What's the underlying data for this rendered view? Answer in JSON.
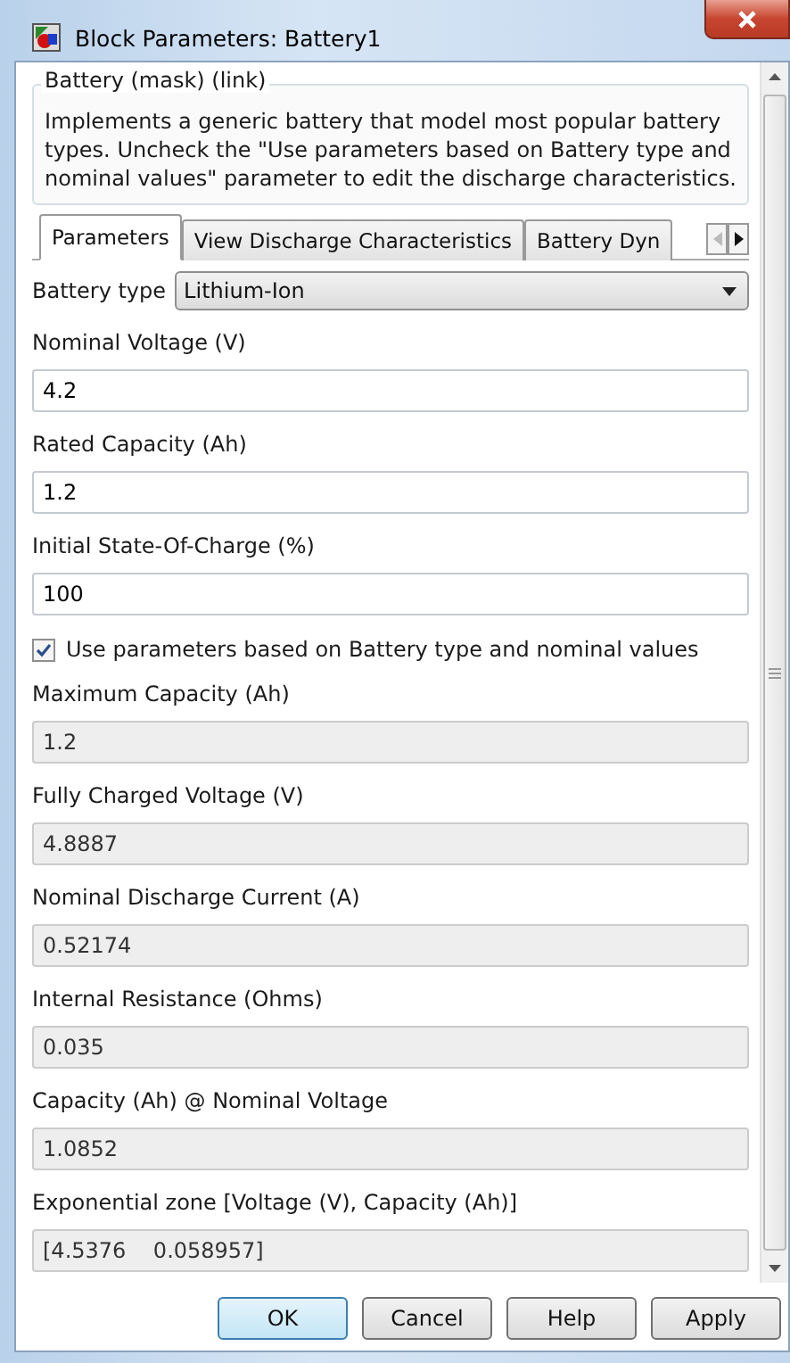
{
  "window": {
    "title": "Block Parameters: Battery1"
  },
  "description": {
    "title": "Battery (mask) (link)",
    "text": "Implements a generic battery that model most popular battery types. Uncheck the \"Use parameters based on Battery type and nominal values\" parameter to edit the discharge characteristics."
  },
  "tabs": [
    {
      "label": "Parameters",
      "selected": true
    },
    {
      "label": "View Discharge Characteristics",
      "selected": false
    },
    {
      "label": "Battery Dyn",
      "selected": false
    }
  ],
  "battery_type": {
    "label": "Battery type",
    "value": "Lithium-Ion"
  },
  "parameters": [
    {
      "kind": "field",
      "label": "Nominal Voltage (V)",
      "value": "4.2",
      "disabled": false
    },
    {
      "kind": "field",
      "label": "Rated Capacity (Ah)",
      "value": "1.2",
      "disabled": false
    },
    {
      "kind": "field",
      "label": "Initial State-Of-Charge (%)",
      "value": "100",
      "disabled": false
    },
    {
      "kind": "checkbox",
      "label": "Use parameters based on Battery type and nominal values",
      "checked": true
    },
    {
      "kind": "field",
      "label": "Maximum Capacity (Ah)",
      "value": "1.2",
      "disabled": true
    },
    {
      "kind": "field",
      "label": "Fully Charged Voltage (V)",
      "value": "4.8887",
      "disabled": true
    },
    {
      "kind": "field",
      "label": "Nominal Discharge Current (A)",
      "value": "0.52174",
      "disabled": true
    },
    {
      "kind": "field",
      "label": "Internal Resistance (Ohms)",
      "value": "0.035",
      "disabled": true
    },
    {
      "kind": "field",
      "label": "Capacity (Ah) @ Nominal Voltage",
      "value": "1.0852",
      "disabled": true
    },
    {
      "kind": "field",
      "label": "Exponential zone [Voltage (V), Capacity (Ah)]",
      "value": "[4.5376    0.058957]",
      "disabled": true
    }
  ],
  "buttons": [
    {
      "label": "OK",
      "default": true
    },
    {
      "label": "Cancel",
      "default": false
    },
    {
      "label": "Help",
      "default": false
    },
    {
      "label": "Apply",
      "default": false
    }
  ]
}
